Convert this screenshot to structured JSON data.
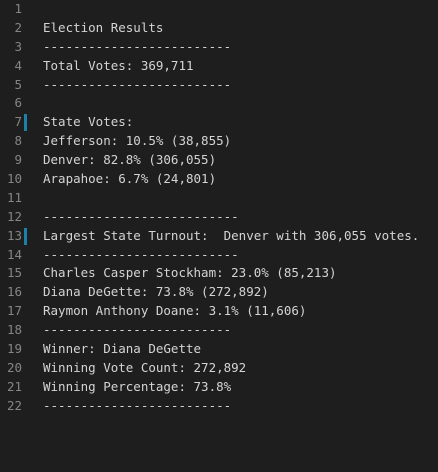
{
  "editor": {
    "lines": [
      {
        "number": "1",
        "text": "",
        "modified": false
      },
      {
        "number": "2",
        "text": "Election Results",
        "modified": false
      },
      {
        "number": "3",
        "text": "-------------------------",
        "modified": false
      },
      {
        "number": "4",
        "text": "Total Votes: 369,711",
        "modified": false
      },
      {
        "number": "5",
        "text": "-------------------------",
        "modified": false
      },
      {
        "number": "6",
        "text": "",
        "modified": false
      },
      {
        "number": "7",
        "text": "State Votes:",
        "modified": true
      },
      {
        "number": "8",
        "text": "Jefferson: 10.5% (38,855)",
        "modified": false
      },
      {
        "number": "9",
        "text": "Denver: 82.8% (306,055)",
        "modified": false
      },
      {
        "number": "10",
        "text": "Arapahoe: 6.7% (24,801)",
        "modified": false
      },
      {
        "number": "11",
        "text": "",
        "modified": false
      },
      {
        "number": "12",
        "text": "--------------------------",
        "modified": false
      },
      {
        "number": "13",
        "text": "Largest State Turnout:  Denver with 306,055 votes.",
        "modified": true
      },
      {
        "number": "14",
        "text": "--------------------------",
        "modified": false
      },
      {
        "number": "15",
        "text": "Charles Casper Stockham: 23.0% (85,213)",
        "modified": false
      },
      {
        "number": "16",
        "text": "Diana DeGette: 73.8% (272,892)",
        "modified": false
      },
      {
        "number": "17",
        "text": "Raymon Anthony Doane: 3.1% (11,606)",
        "modified": false
      },
      {
        "number": "18",
        "text": "-------------------------",
        "modified": false
      },
      {
        "number": "19",
        "text": "Winner: Diana DeGette",
        "modified": false
      },
      {
        "number": "20",
        "text": "Winning Vote Count: 272,892",
        "modified": false
      },
      {
        "number": "21",
        "text": "Winning Percentage: 73.8%",
        "modified": false
      },
      {
        "number": "22",
        "text": "-------------------------",
        "modified": false
      }
    ]
  },
  "colors": {
    "background": "#1e1e1e",
    "line_number": "#858585",
    "text": "#d4d4d4",
    "modified_marker": "#1b81a8"
  }
}
